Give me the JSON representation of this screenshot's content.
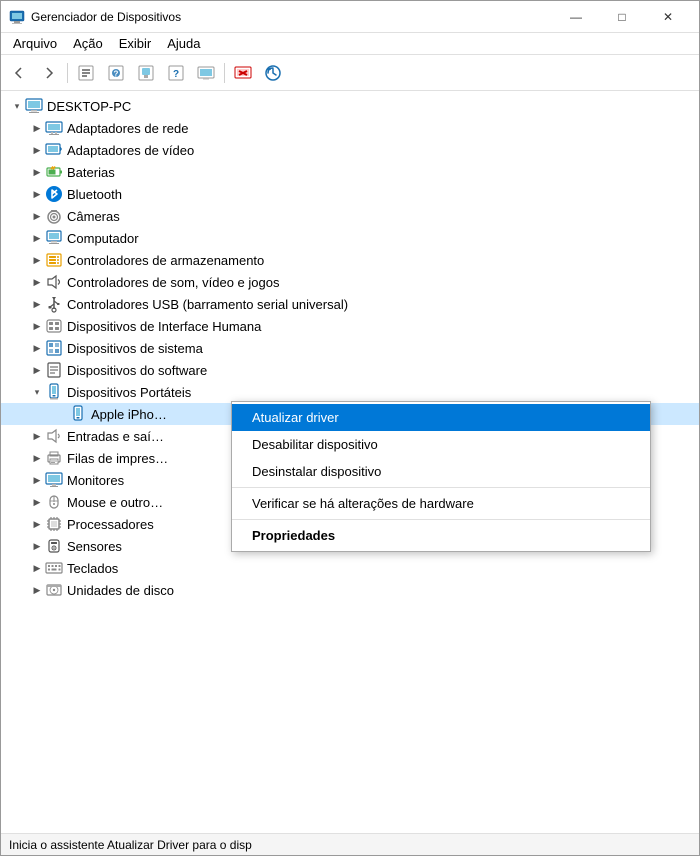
{
  "window": {
    "title": "Gerenciador de Dispositivos",
    "title_icon": "💻",
    "controls": {
      "minimize": "—",
      "maximize": "□",
      "close": "✕"
    }
  },
  "menu": {
    "items": [
      "Arquivo",
      "Ação",
      "Exibir",
      "Ajuda"
    ]
  },
  "tree": {
    "root": "DESKTOP-PC",
    "items": [
      {
        "label": "Adaptadores de rede",
        "level": 1,
        "expanded": false
      },
      {
        "label": "Adaptadores de vídeo",
        "level": 1,
        "expanded": false
      },
      {
        "label": "Baterias",
        "level": 1,
        "expanded": false
      },
      {
        "label": "Bluetooth",
        "level": 1,
        "expanded": false
      },
      {
        "label": "Câmeras",
        "level": 1,
        "expanded": false
      },
      {
        "label": "Computador",
        "level": 1,
        "expanded": false
      },
      {
        "label": "Controladores de armazenamento",
        "level": 1,
        "expanded": false
      },
      {
        "label": "Controladores de som, vídeo e jogos",
        "level": 1,
        "expanded": false
      },
      {
        "label": "Controladores USB (barramento serial universal)",
        "level": 1,
        "expanded": false
      },
      {
        "label": "Dispositivos de Interface Humana",
        "level": 1,
        "expanded": false
      },
      {
        "label": "Dispositivos de sistema",
        "level": 1,
        "expanded": false
      },
      {
        "label": "Dispositivos do software",
        "level": 1,
        "expanded": false
      },
      {
        "label": "Dispositivos Portáteis",
        "level": 1,
        "expanded": true
      },
      {
        "label": "Apple iPho…",
        "level": 2,
        "expanded": false,
        "selected": true
      },
      {
        "label": "Entradas e saí…",
        "level": 1,
        "expanded": false
      },
      {
        "label": "Filas de impres…",
        "level": 1,
        "expanded": false
      },
      {
        "label": "Monitores",
        "level": 1,
        "expanded": false
      },
      {
        "label": "Mouse e outro…",
        "level": 1,
        "expanded": false
      },
      {
        "label": "Processadores",
        "level": 1,
        "expanded": false
      },
      {
        "label": "Sensores",
        "level": 1,
        "expanded": false
      },
      {
        "label": "Teclados",
        "level": 1,
        "expanded": false
      },
      {
        "label": "Unidades de disco",
        "level": 1,
        "expanded": false
      }
    ]
  },
  "context_menu": {
    "items": [
      {
        "label": "Atualizar driver",
        "highlighted": true,
        "bold": false
      },
      {
        "label": "Desabilitar dispositivo",
        "highlighted": false,
        "bold": false
      },
      {
        "label": "Desinstalar dispositivo",
        "highlighted": false,
        "bold": false
      },
      {
        "label": "Verificar se há alterações de hardware",
        "highlighted": false,
        "bold": false
      },
      {
        "label": "Propriedades",
        "highlighted": false,
        "bold": true
      }
    ]
  },
  "status_bar": {
    "text": "Inicia o assistente Atualizar Driver para o disp"
  }
}
